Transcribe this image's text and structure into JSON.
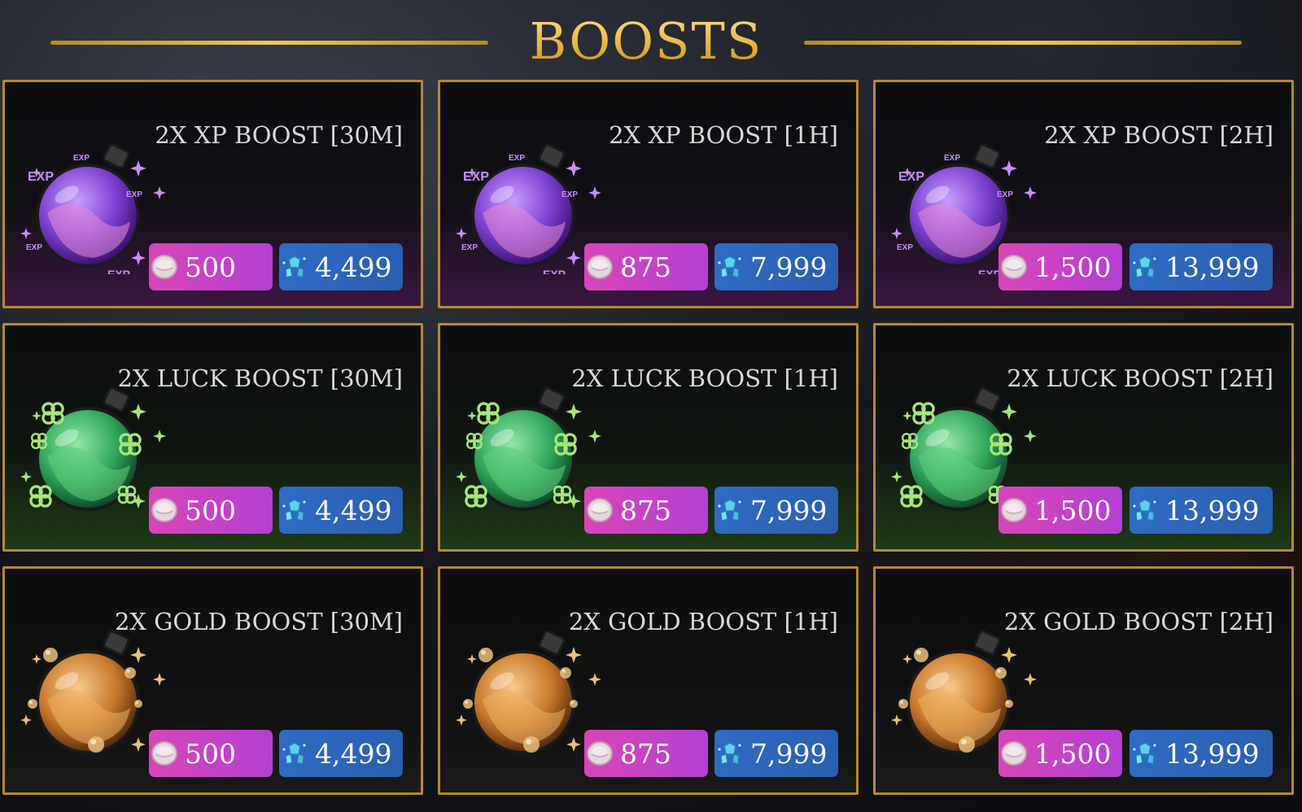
{
  "title": "BOOSTS",
  "colors": {
    "accent_gold": "#f2c64f",
    "border_gold": "#b5892e",
    "price_pink": "#d845b8",
    "price_blue": "#2f6bc4",
    "xp_potion": "#7b3fd0",
    "luck_potion": "#2fa55a",
    "gold_potion": "#c8782a"
  },
  "boosts": [
    {
      "name": "2X XP BOOST [30M]",
      "type": "xp",
      "icon": "xp-potion-icon",
      "coin_price": "500",
      "gem_price": "4,499"
    },
    {
      "name": "2X XP BOOST [1H]",
      "type": "xp",
      "icon": "xp-potion-icon",
      "coin_price": "875",
      "gem_price": "7,999"
    },
    {
      "name": "2X XP BOOST [2H]",
      "type": "xp",
      "icon": "xp-potion-icon",
      "coin_price": "1,500",
      "gem_price": "13,999"
    },
    {
      "name": "2X LUCK BOOST [30M]",
      "type": "luck",
      "icon": "luck-potion-icon",
      "coin_price": "500",
      "gem_price": "4,499"
    },
    {
      "name": "2X LUCK BOOST [1H]",
      "type": "luck",
      "icon": "luck-potion-icon",
      "coin_price": "875",
      "gem_price": "7,999"
    },
    {
      "name": "2X LUCK BOOST [2H]",
      "type": "luck",
      "icon": "luck-potion-icon",
      "coin_price": "1,500",
      "gem_price": "13,999"
    },
    {
      "name": "2X GOLD BOOST [30M]",
      "type": "gold",
      "icon": "gold-potion-icon",
      "coin_price": "500",
      "gem_price": "4,499"
    },
    {
      "name": "2X GOLD BOOST [1H]",
      "type": "gold",
      "icon": "gold-potion-icon",
      "coin_price": "875",
      "gem_price": "7,999"
    },
    {
      "name": "2X GOLD BOOST [2H]",
      "type": "gold",
      "icon": "gold-potion-icon",
      "coin_price": "1,500",
      "gem_price": "13,999"
    }
  ],
  "xp_potion_label": "EXP"
}
